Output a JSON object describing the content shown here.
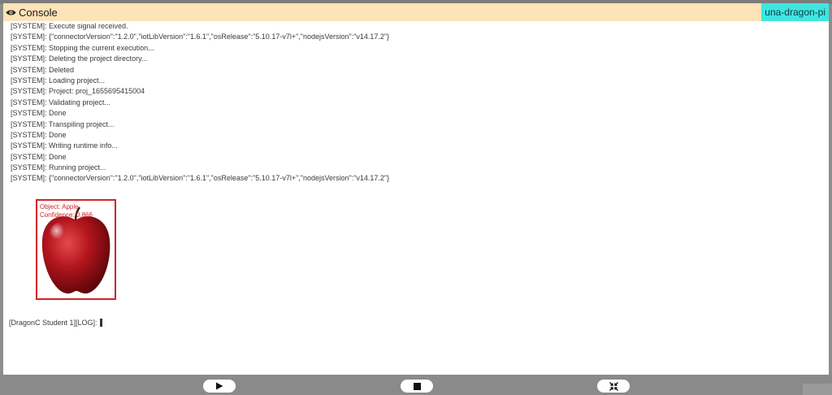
{
  "header": {
    "title": "Console",
    "title_icon": "eye-icon",
    "device_badge": "una-dragon-pi"
  },
  "colors": {
    "header_bg": "#fde3b8",
    "badge_bg": "#3fe6e0",
    "detection_box": "#d2232a"
  },
  "log": [
    "[SYSTEM]: Execute signal received.",
    "[SYSTEM]: {\"connectorVersion\":\"1.2.0\",\"iotLibVersion\":\"1.6.1\",\"osRelease\":\"5.10.17-v7l+\",\"nodejsVersion\":\"v14.17.2\"}",
    "[SYSTEM]: Stopping the current execution...",
    "[SYSTEM]: Deleting the project directory...",
    "[SYSTEM]: Deleted",
    "[SYSTEM]: Loading project...",
    "[SYSTEM]: Project: proj_1655695415004",
    "[SYSTEM]: Validating project...",
    "[SYSTEM]: Done",
    "[SYSTEM]: Transpiling project...",
    "[SYSTEM]: Done",
    "[SYSTEM]: Writing runtime info...",
    "[SYSTEM]: Done",
    "[SYSTEM]: Running project...",
    "[SYSTEM]: {\"connectorVersion\":\"1.2.0\",\"iotLibVersion\":\"1.6.1\",\"osRelease\":\"5.10.17-v7l+\",\"nodejsVersion\":\"v14.17.2\"}"
  ],
  "detection": {
    "object_label": "Object: Apple",
    "confidence_label": "Confidence: 0.866",
    "image_icon": "apple-image"
  },
  "prompt": "[DragonC Student 1][LOG]:",
  "controls": {
    "play_icon": "play-icon",
    "stop_icon": "stop-icon",
    "collapse_icon": "collapse-icon"
  }
}
